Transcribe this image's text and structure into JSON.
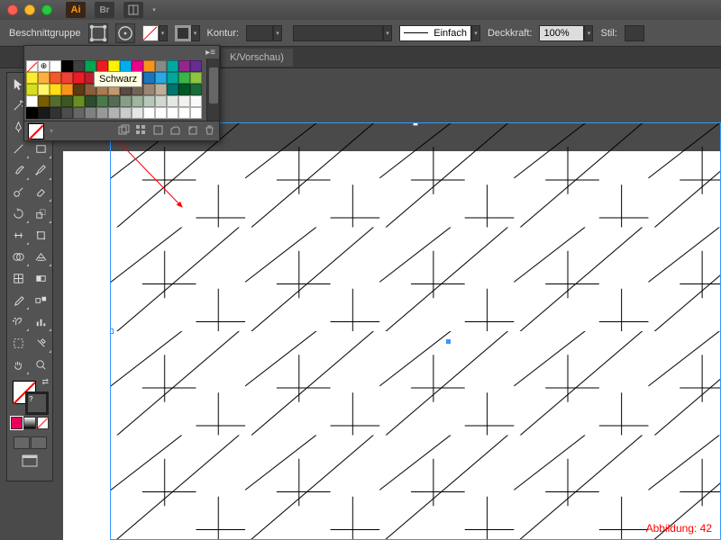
{
  "titlebar": {
    "app": "Ai",
    "bridge": "Br"
  },
  "control": {
    "objectType": "Beschnittgruppe",
    "konturLabel": "Kontur:",
    "deckkraftLabel": "Deckkraft:",
    "deckkraftValue": "100%",
    "stilLabel": "Stil:",
    "strokeStyle": "Einfach"
  },
  "tab": {
    "title": "K/Vorschau)"
  },
  "swatches": {
    "tooltip": "Schwarz",
    "row1": [
      "none",
      "reg",
      "#ffffff",
      "#000000",
      "#404040",
      "#00a651",
      "#ed1c24",
      "#fff200",
      "#00aeef",
      "#ec008c",
      "#f7941d",
      "#898989",
      "#00a99d",
      "#92278f",
      "#662d91"
    ],
    "row2": [
      "#f9ed32",
      "#fbb040",
      "#f15a29",
      "#ef4136",
      "#ed1c24",
      "#be1e2d",
      "#9e1f63",
      "#92278f",
      "#662d91",
      "#2e3192",
      "#1b75bc",
      "#27aae1",
      "#00a79d",
      "#39b54a",
      "#8dc63f"
    ],
    "row3": [
      "#d7df23",
      "#fff568",
      "#ffde17",
      "#f7941d",
      "#603913",
      "#8b5e3c",
      "#a97c50",
      "#c49a6c",
      "#594a42",
      "#736357",
      "#998675",
      "#bcaf9c",
      "#00746b",
      "#005826",
      "#1a6b3b"
    ],
    "row4": [
      "#fff",
      "#7a5c00",
      "#556b2f",
      "#3e5622",
      "#6b8e23",
      "#2e4d2e",
      "#4a7a4a",
      "#556b55",
      "#889e88",
      "#a0b4a0",
      "#b8c8b8",
      "#d0d8d0",
      "#e4e8e4",
      "#f0f2f0",
      "#fafafa"
    ],
    "row5": [
      "#000",
      "#1a1a1a",
      "#333",
      "#4d4d4d",
      "#666",
      "#808080",
      "#999",
      "#b3b3b3",
      "#ccc",
      "#e6e6e6",
      "#fff",
      "#fff",
      "#fff",
      "#fff",
      "#fff"
    ]
  },
  "caption": "Abbildung: 42"
}
